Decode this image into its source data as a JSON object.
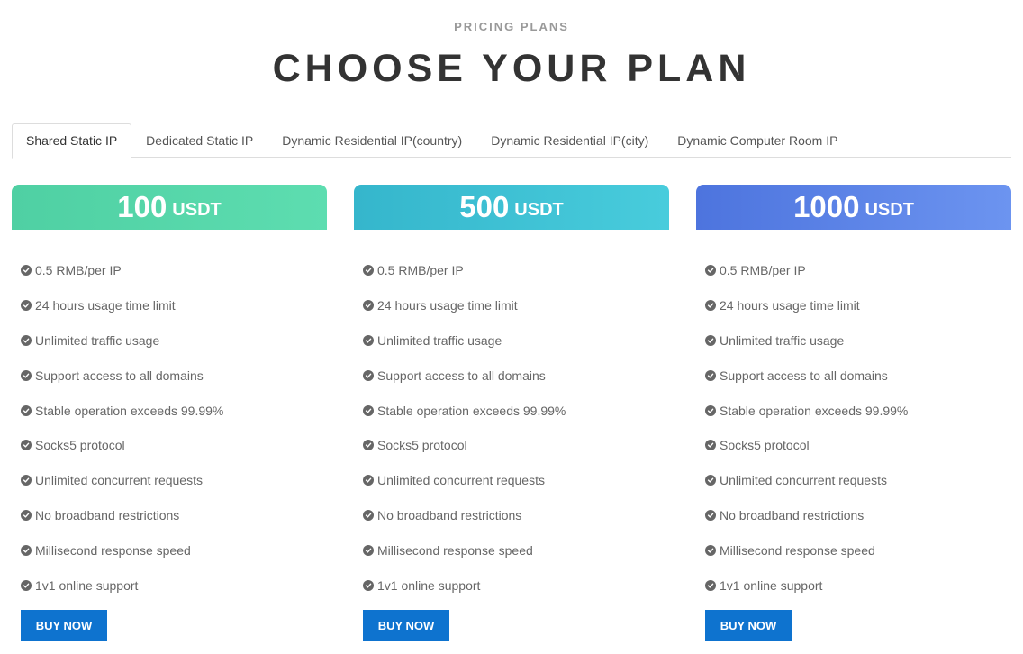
{
  "header": {
    "eyebrow": "PRICING PLANS",
    "title": "CHOOSE YOUR PLAN"
  },
  "tabs": [
    {
      "label": "Shared Static IP",
      "active": true
    },
    {
      "label": "Dedicated Static IP",
      "active": false
    },
    {
      "label": "Dynamic Residential IP(country)",
      "active": false
    },
    {
      "label": "Dynamic Residential IP(city)",
      "active": false
    },
    {
      "label": "Dynamic Computer Room IP",
      "active": false
    }
  ],
  "plans": [
    {
      "price": "100",
      "unit": "USDT",
      "gradient": [
        "#4fd0a3",
        "#5dddb0"
      ],
      "features": [
        "0.5 RMB/per IP",
        "24 hours usage time limit",
        "Unlimited traffic usage",
        "Support access to all domains",
        "Stable operation exceeds 99.99%",
        "Socks5 protocol",
        "Unlimited concurrent requests",
        "No broadband restrictions",
        "Millisecond response speed",
        "1v1 online support"
      ],
      "buy_label": "BUY NOW"
    },
    {
      "price": "500",
      "unit": "USDT",
      "gradient": [
        "#35b6cc",
        "#48ccdc"
      ],
      "features": [
        "0.5 RMB/per IP",
        "24 hours usage time limit",
        "Unlimited traffic usage",
        "Support access to all domains",
        "Stable operation exceeds 99.99%",
        "Socks5 protocol",
        "Unlimited concurrent requests",
        "No broadband restrictions",
        "Millisecond response speed",
        "1v1 online support"
      ],
      "buy_label": "BUY NOW"
    },
    {
      "price": "1000",
      "unit": "USDT",
      "gradient": [
        "#4d74de",
        "#6c94f0"
      ],
      "features": [
        "0.5 RMB/per IP",
        "24 hours usage time limit",
        "Unlimited traffic usage",
        "Support access to all domains",
        "Stable operation exceeds 99.99%",
        "Socks5 protocol",
        "Unlimited concurrent requests",
        "No broadband restrictions",
        "Millisecond response speed",
        "1v1 online support"
      ],
      "buy_label": "BUY NOW"
    }
  ],
  "colors": {
    "buy_button": "#0e73cf",
    "check_icon": "#666666"
  },
  "icons": {
    "feature": "check-circle-icon"
  }
}
